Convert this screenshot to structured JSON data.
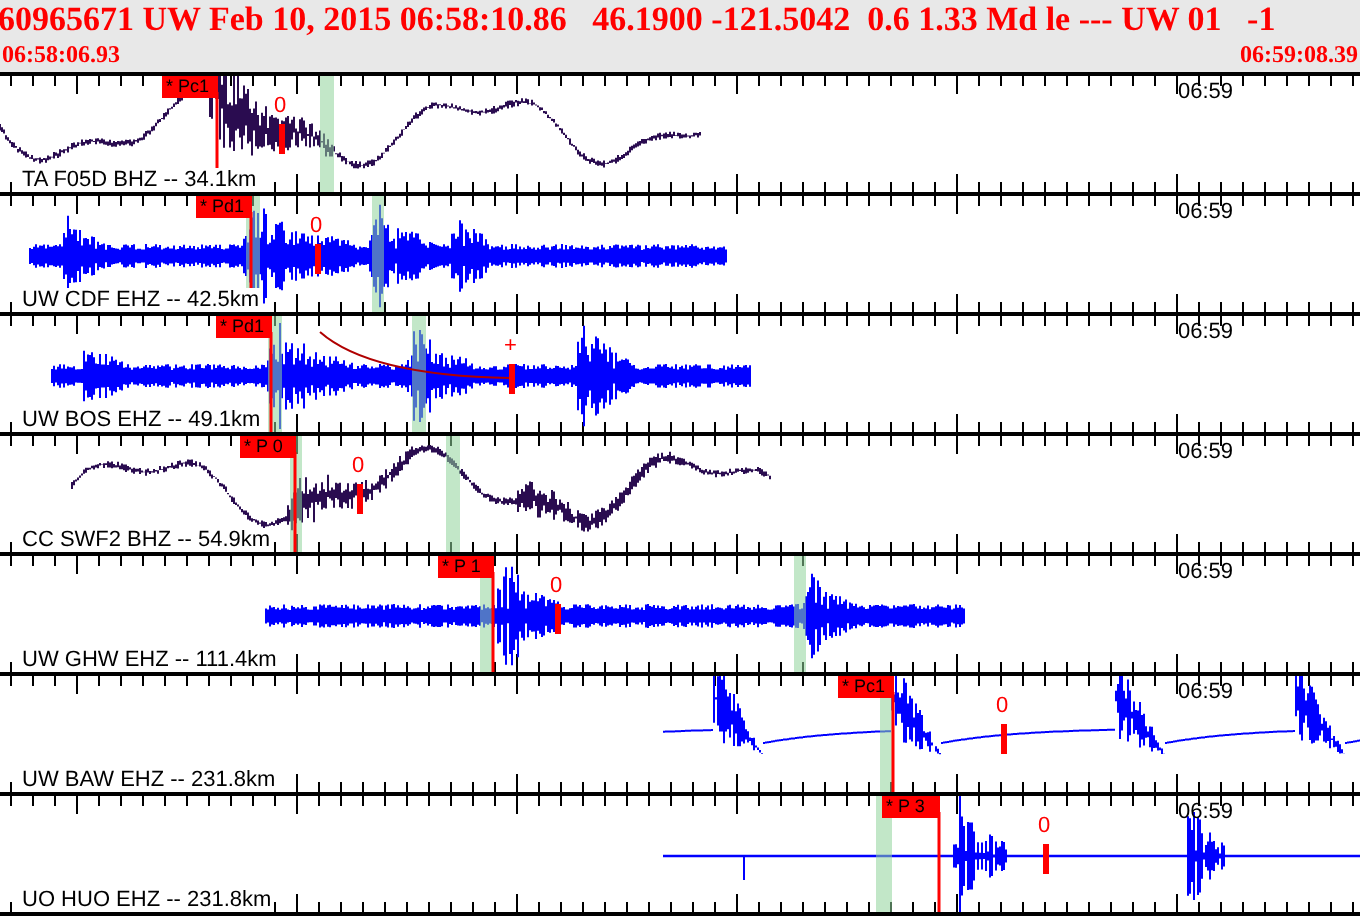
{
  "header": {
    "title": "60965671 UW Feb 10, 2015 06:58:10.86   46.1900 -121.5042  0.6 1.33 Md le --- UW 01   -1",
    "start_time": "06:58:06.93",
    "end_time": "06:59:08.39"
  },
  "traces": [
    {
      "station": "TA F05D BHZ -- 34.1km",
      "color": "#2a0c50",
      "pick": "* Pc1",
      "coda": "0",
      "time_label": "06:59"
    },
    {
      "station": "UW CDF EHZ -- 42.5km",
      "color": "#0000ff",
      "pick": "* Pd1",
      "coda": "0",
      "time_label": "06:59"
    },
    {
      "station": "UW BOS EHZ -- 49.1km",
      "color": "#0000ff",
      "pick": "* Pd1",
      "coda": "+",
      "time_label": "06:59"
    },
    {
      "station": "CC SWF2 BHZ -- 54.9km",
      "color": "#2a0c50",
      "pick": "* P 0",
      "coda": "0",
      "time_label": "06:59"
    },
    {
      "station": "UW GHW EHZ -- 111.4km",
      "color": "#0000ff",
      "pick": "* P 1",
      "coda": "0",
      "time_label": "06:59"
    },
    {
      "station": "UW BAW EHZ -- 231.8km",
      "color": "#0000ff",
      "pick": "* Pc1",
      "coda": "0",
      "time_label": "06:59"
    },
    {
      "station": "UO HUO EHZ -- 231.8km",
      "color": "#0000ff",
      "pick": "* P 3",
      "coda": "0",
      "time_label": "06:59"
    }
  ]
}
